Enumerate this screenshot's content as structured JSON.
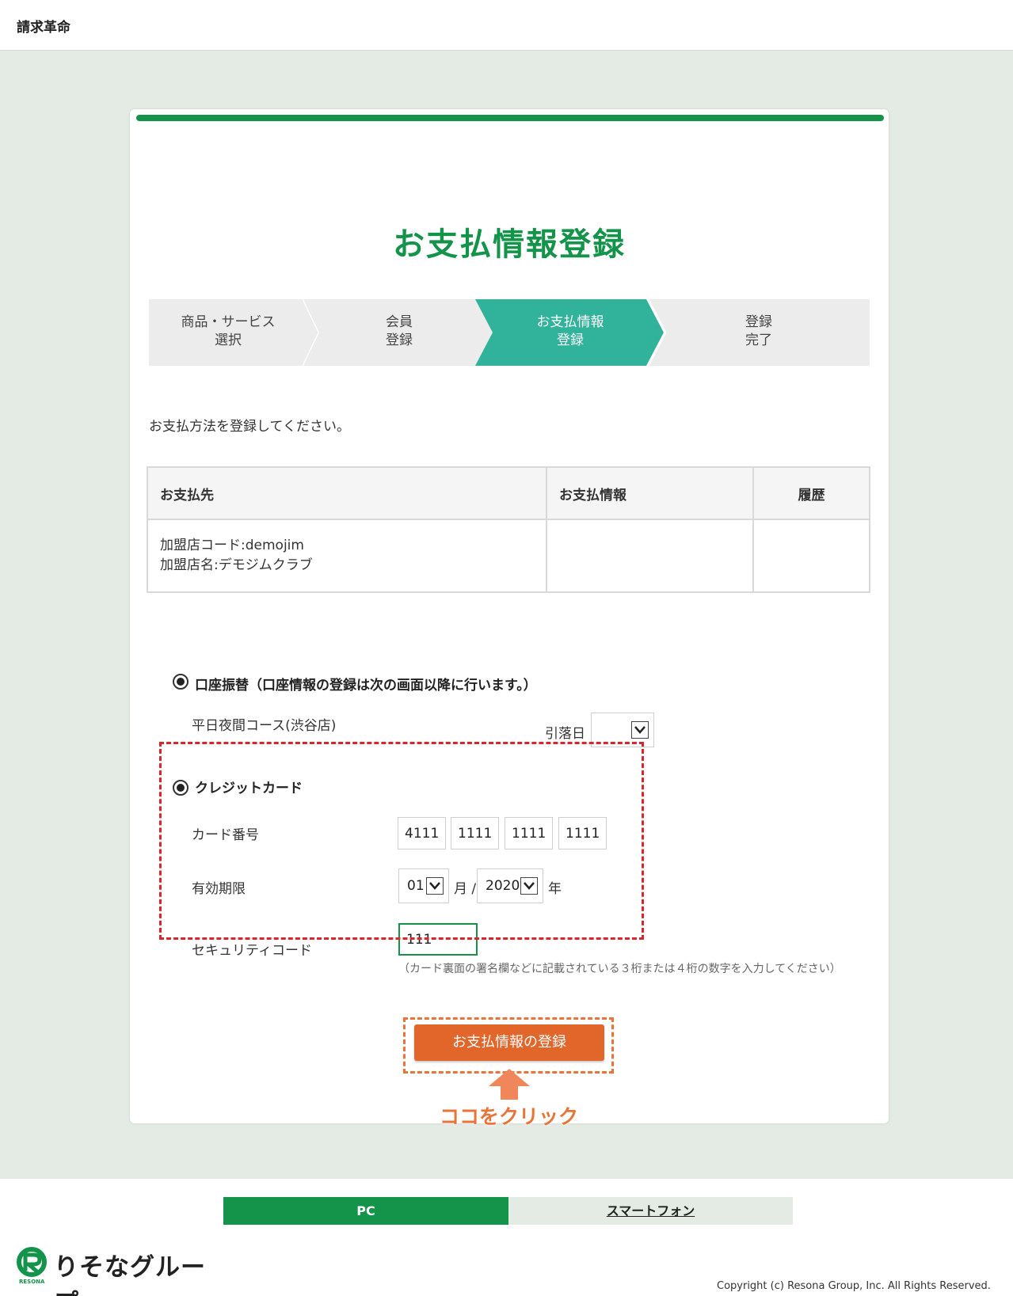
{
  "header": {
    "brand": "請求革命"
  },
  "page": {
    "title": "お支払情報登録",
    "intro": "お支払方法を登録してください。"
  },
  "steps": [
    {
      "line1": "商品・サービス",
      "line2": "選択"
    },
    {
      "line1": "会員",
      "line2": "登録"
    },
    {
      "line1": "お支払情報",
      "line2": "登録"
    },
    {
      "line1": "登録",
      "line2": "完了"
    }
  ],
  "table": {
    "headers": [
      "お支払先",
      "お支払情報",
      "履歴"
    ],
    "row": {
      "store_code": "加盟店コード:demojim",
      "store_name": "加盟店名:デモジムクラブ",
      "payment_info": "",
      "history": ""
    }
  },
  "bank": {
    "option_label": "口座振替（口座情報の登録は次の画面以降に行います。）",
    "course": "平日夜間コース(渋谷店)",
    "debit_day_label": "引落日",
    "debit_day_value": ""
  },
  "card": {
    "option_label": "クレジットカード",
    "number_label": "カード番号",
    "number_parts": [
      "4111",
      "1111",
      "1111",
      "1111"
    ],
    "expiry_label": "有効期限",
    "expiry_month": "01",
    "month_unit": "月 /",
    "expiry_year": "2020",
    "year_unit": "年",
    "security_label": "セキュリティコード",
    "security_value": "111",
    "security_note": "（カード裏面の署名欄などに記載されている３桁または４桁の数字を入力してください）"
  },
  "submit": {
    "label": "お支払情報の登録"
  },
  "annotation": {
    "text": "ココをクリック"
  },
  "footer": {
    "tab_pc": "PC",
    "tab_sp": "スマートフォン",
    "logo_text": "りそなグループ",
    "logo_sub": "RESONA",
    "copyright": "Copyright (c) Resona Group, Inc. All Rights Reserved."
  },
  "colors": {
    "brand_green": "#14934a",
    "step_active": "#30b39a",
    "button_orange": "#e2652a",
    "highlight_red": "#d9252b"
  }
}
